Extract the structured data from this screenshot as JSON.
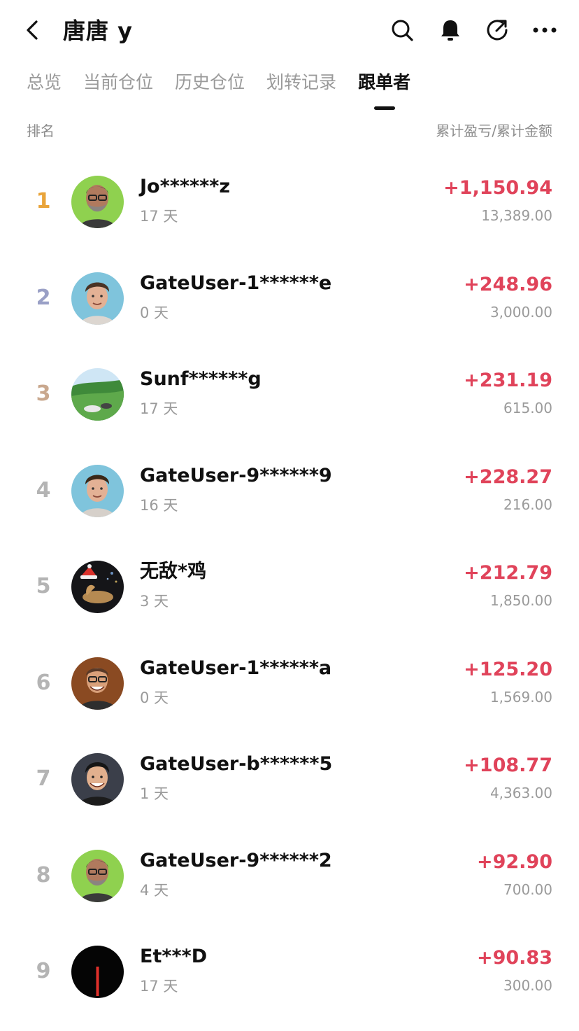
{
  "header": {
    "title": "唐唐 y",
    "icons": [
      "back-arrow-icon",
      "search-icon",
      "bell-icon",
      "share-icon",
      "more-icon"
    ]
  },
  "tabs": [
    "总览",
    "当前仓位",
    "历史仓位",
    "划转记录",
    "跟单者"
  ],
  "active_tab": "跟单者",
  "column_headers": {
    "left": "排名",
    "right": "累计盈亏/累计金额"
  },
  "colors": {
    "profit": "#e0435a",
    "rank_gold": "#e9a43a",
    "rank_silver": "#9aa0c6",
    "rank_bronze": "#c9a88e",
    "rank_other": "#b4b4b4"
  },
  "followers": [
    {
      "rank": "1",
      "name": "Jo******z",
      "days": "17 天",
      "pnl": "+1,150.94",
      "amount": "13,389.00"
    },
    {
      "rank": "2",
      "name": "GateUser-1******e",
      "days": "0 天",
      "pnl": "+248.96",
      "amount": "3,000.00"
    },
    {
      "rank": "3",
      "name": "Sunf******g",
      "days": "17 天",
      "pnl": "+231.19",
      "amount": "615.00"
    },
    {
      "rank": "4",
      "name": "GateUser-9******9",
      "days": "16 天",
      "pnl": "+228.27",
      "amount": "216.00"
    },
    {
      "rank": "5",
      "name": "无敌*鸡",
      "days": "3 天",
      "pnl": "+212.79",
      "amount": "1,850.00"
    },
    {
      "rank": "6",
      "name": "GateUser-1******a",
      "days": "0 天",
      "pnl": "+125.20",
      "amount": "1,569.00"
    },
    {
      "rank": "7",
      "name": "GateUser-b******5",
      "days": "1 天",
      "pnl": "+108.77",
      "amount": "4,363.00"
    },
    {
      "rank": "8",
      "name": "GateUser-9******2",
      "days": "4 天",
      "pnl": "+92.90",
      "amount": "700.00"
    },
    {
      "rank": "9",
      "name": "Et***D",
      "days": "17 天",
      "pnl": "+90.83",
      "amount": "300.00"
    }
  ]
}
